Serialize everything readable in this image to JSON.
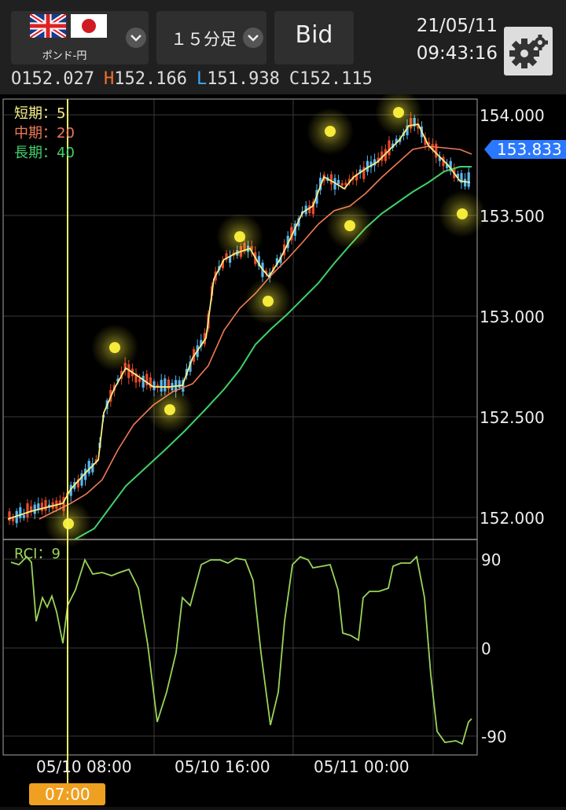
{
  "header": {
    "pair_label": "ポンド-円",
    "timeframe_label": "１５分足",
    "price_type_label": "Bid",
    "date": "21/05/11",
    "time": "09:43:16"
  },
  "ohlc": {
    "o_label": "O",
    "o_value": "152.027",
    "h_label": "H",
    "h_value": "152.166",
    "l_label": "L",
    "l_value": "151.938",
    "c_label": "C",
    "c_value": "152.115",
    "colors": {
      "o": "#dddddd",
      "h": "#f07030",
      "l": "#38a8ff",
      "c": "#dddddd"
    }
  },
  "legend": {
    "short_label": "短期：5",
    "mid_label": "中期：20",
    "long_label": "長期：40"
  },
  "rci_label": "RCI：9",
  "price_axis": [
    "154.000",
    "153.500",
    "153.000",
    "152.500",
    "152.000"
  ],
  "current_price": "153.833",
  "rci_axis": [
    "90",
    "0",
    "-90"
  ],
  "time_axis": [
    "05/10 08:00",
    "05/10 16:00",
    "05/11 00:00"
  ],
  "crosshair_time": "07:00",
  "colors": {
    "short_ma": "#f5f08a",
    "mid_ma": "#f07a55",
    "long_ma": "#3fd16a",
    "rci": "#9ad45a",
    "up": "#e84a2a",
    "down": "#5ab8f0",
    "crosshair": "#f5f060",
    "marker": "#f5eb3a",
    "price_tag": "#2a78ff",
    "time_tag": "#f0a020"
  },
  "icons": [
    "uk-flag-icon",
    "japan-flag-icon",
    "chevron-down-icon",
    "gear-icon"
  ]
}
